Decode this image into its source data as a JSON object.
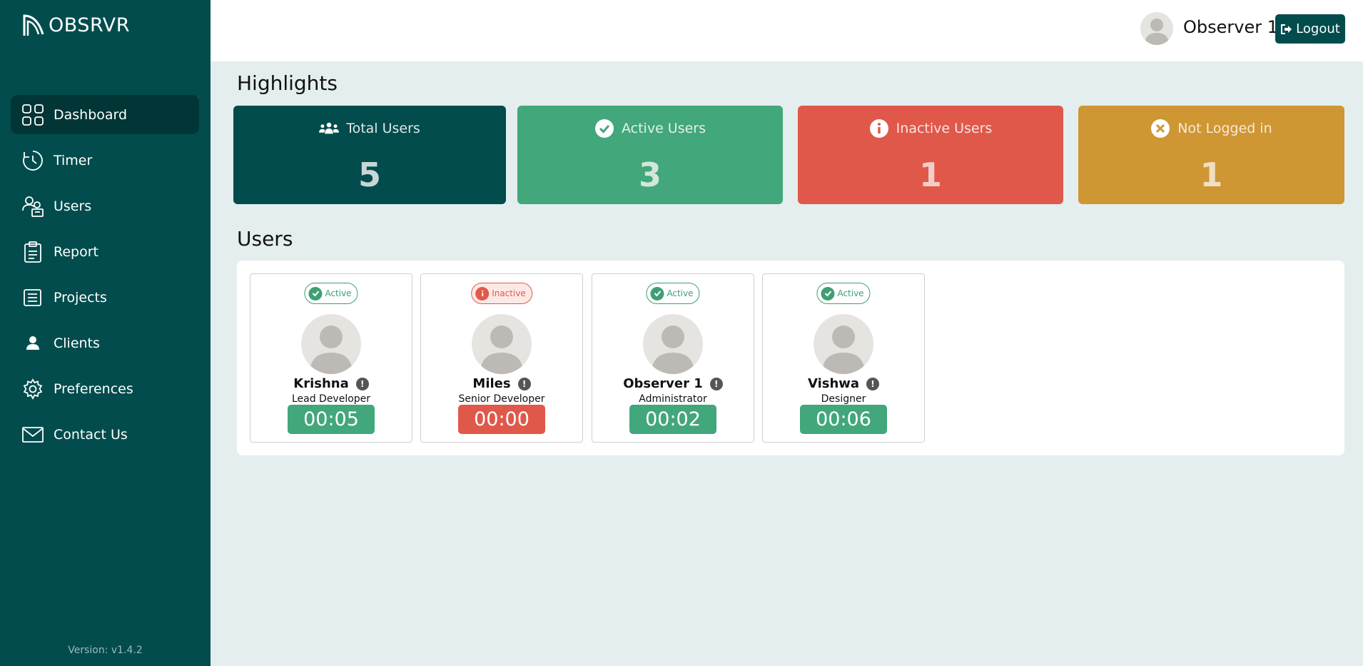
{
  "app": {
    "logo_text": "OBSRVR",
    "version": "Version: v1.4.2"
  },
  "sidebar": {
    "items": [
      {
        "label": "Dashboard",
        "icon": "grid-icon",
        "active": true
      },
      {
        "label": "Timer",
        "icon": "clock-icon",
        "active": false
      },
      {
        "label": "Users",
        "icon": "users-icon",
        "active": false
      },
      {
        "label": "Report",
        "icon": "clipboard-icon",
        "active": false
      },
      {
        "label": "Projects",
        "icon": "list-icon",
        "active": false
      },
      {
        "label": "Clients",
        "icon": "person-icon",
        "active": false
      },
      {
        "label": "Preferences",
        "icon": "gear-icon",
        "active": false
      },
      {
        "label": "Contact Us",
        "icon": "mail-icon",
        "active": false
      }
    ]
  },
  "header": {
    "user_name": "Observer 1",
    "logout_label": "Logout"
  },
  "highlights": {
    "title": "Highlights",
    "cards": [
      {
        "label": "Total Users",
        "value": "5",
        "icon": "users-group-icon",
        "color": "#024c4d"
      },
      {
        "label": "Active Users",
        "value": "3",
        "icon": "check-circle-icon",
        "color": "#42a77b"
      },
      {
        "label": "Inactive Users",
        "value": "1",
        "icon": "info-circle-icon",
        "color": "#e0584a"
      },
      {
        "label": "Not Logged in",
        "value": "1",
        "icon": "x-circle-icon",
        "color": "#cf9634"
      }
    ]
  },
  "users": {
    "title": "Users",
    "list": [
      {
        "status": "Active",
        "name": "Krishna",
        "role": "Lead Developer",
        "timer": "00:05"
      },
      {
        "status": "Inactive",
        "name": "Miles",
        "role": "Senior Developer",
        "timer": "00:00"
      },
      {
        "status": "Active",
        "name": "Observer 1",
        "role": "Administrator",
        "timer": "00:02"
      },
      {
        "status": "Active",
        "name": "Vishwa",
        "role": "Designer",
        "timer": "00:06"
      }
    ]
  },
  "colors": {
    "sidebar": "#024c4d",
    "active": "#42a77b",
    "inactive": "#e0584a",
    "not_logged": "#cf9634"
  }
}
